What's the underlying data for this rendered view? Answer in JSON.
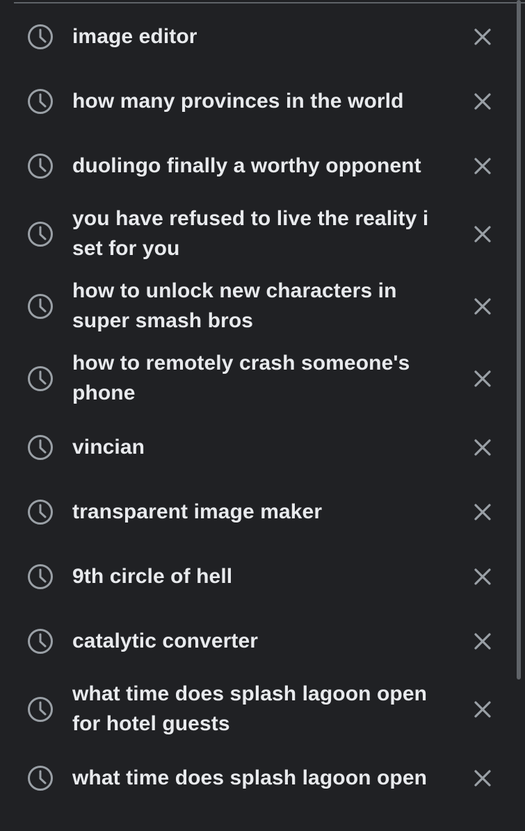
{
  "history": {
    "items": [
      {
        "text": "image editor",
        "lines": 1
      },
      {
        "text": "how many provinces in the world",
        "lines": 1
      },
      {
        "text": "duolingo finally a worthy opponent",
        "lines": 1
      },
      {
        "text": "you have refused to live the reality i set for you",
        "lines": 2
      },
      {
        "text": "how to unlock new characters in super smash bros",
        "lines": 2
      },
      {
        "text": "how to remotely crash someone's phone",
        "lines": 2
      },
      {
        "text": "vincian",
        "lines": 1
      },
      {
        "text": "transparent image maker",
        "lines": 1
      },
      {
        "text": "9th circle of hell",
        "lines": 1
      },
      {
        "text": "catalytic converter",
        "lines": 1
      },
      {
        "text": "what time does splash lagoon open for hotel guests",
        "lines": 2
      },
      {
        "text": "what time does splash lagoon open",
        "lines": 1
      }
    ],
    "icons": {
      "history": "clock-icon",
      "remove": "close-icon"
    },
    "colors": {
      "background": "#202124",
      "text": "#e8eaed",
      "icon": "#9aa0a6"
    }
  }
}
